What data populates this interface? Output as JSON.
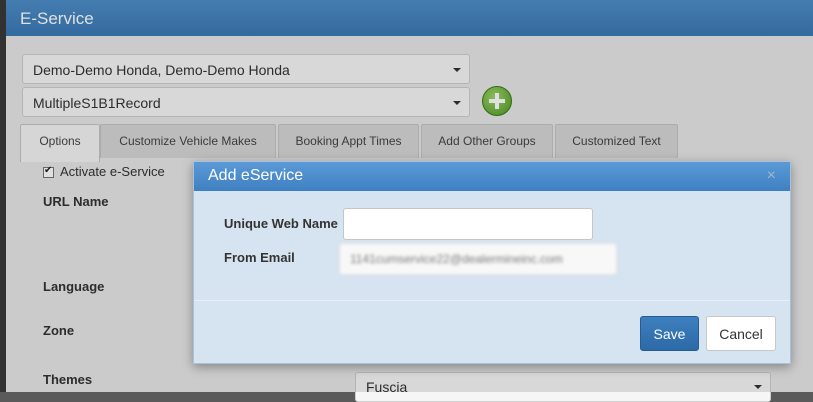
{
  "window": {
    "title": "E-Service"
  },
  "dealer_select": {
    "value": "Demo-Demo Honda, Demo-Demo Honda"
  },
  "record_select": {
    "value": "MultipleS1B1Record"
  },
  "tabs": [
    {
      "label": "Options"
    },
    {
      "label": "Customize Vehicle Makes"
    },
    {
      "label": "Booking Appt Times"
    },
    {
      "label": "Add Other Groups"
    },
    {
      "label": "Customized Text"
    }
  ],
  "form": {
    "activate_label": "Activate e-Service",
    "activate_checked": true,
    "url_name_label": "URL Name",
    "language_label": "Language",
    "zone_label": "Zone",
    "themes_label": "Themes",
    "themes_value": "Fuscia"
  },
  "modal": {
    "title": "Add eService",
    "close_glyph": "×",
    "web_name_label": "Unique Web Name",
    "web_name_value": "",
    "from_email_label": "From Email",
    "from_email_value": "1141cumservice22@dealermineinc.com",
    "save_label": "Save",
    "cancel_label": "Cancel"
  }
}
